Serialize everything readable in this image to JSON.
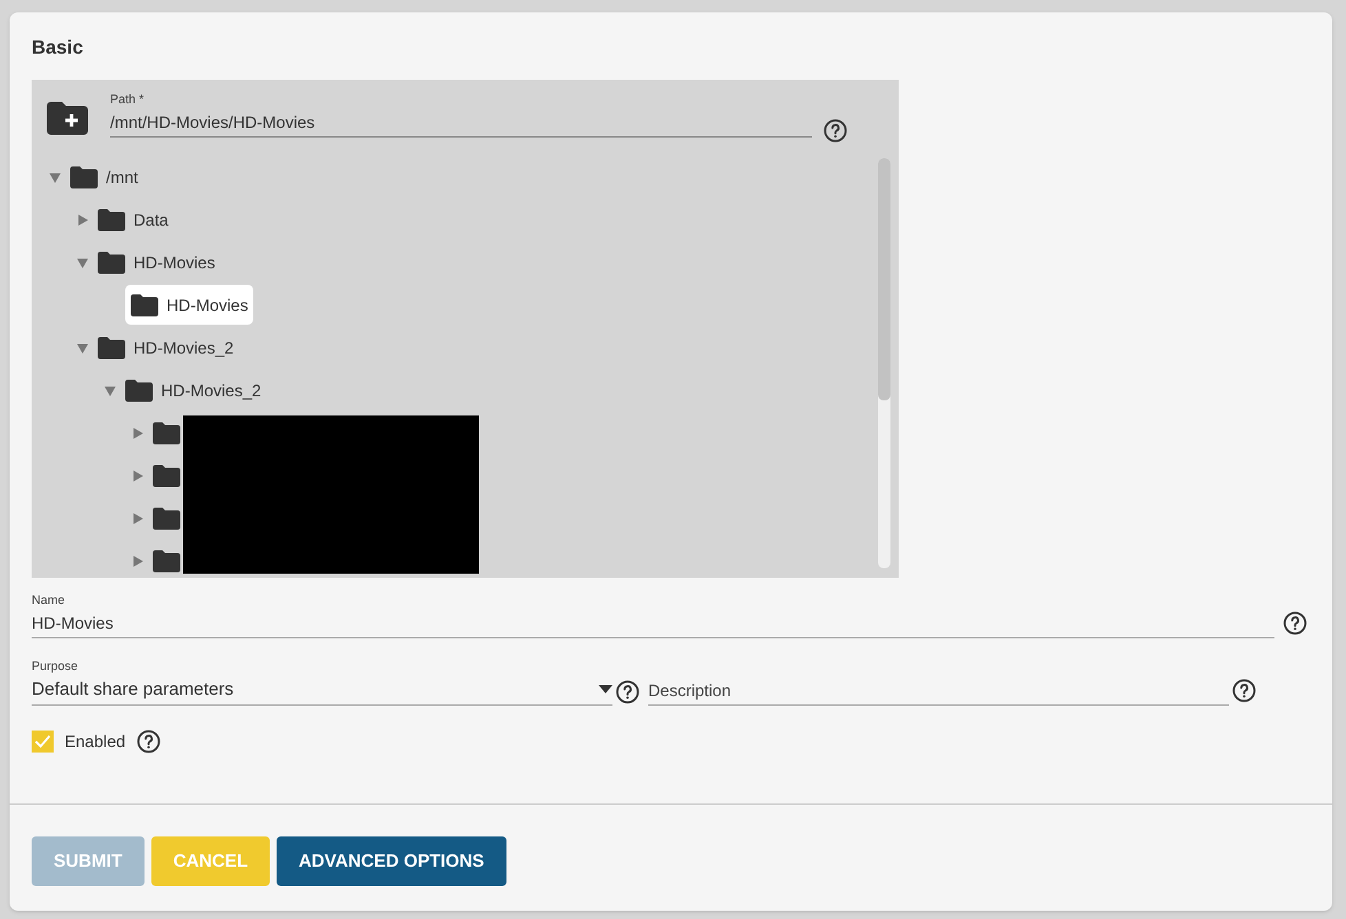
{
  "section_title": "Basic",
  "path_field": {
    "label": "Path *",
    "value": "/mnt/HD-Movies/HD-Movies"
  },
  "tree": [
    {
      "name": "/mnt",
      "expanded": true,
      "selected": false,
      "children": [
        {
          "name": "Data",
          "expanded": false,
          "selected": false
        },
        {
          "name": "HD-Movies",
          "expanded": true,
          "selected": false,
          "children": [
            {
              "name": "HD-Movies",
              "selected": true
            }
          ]
        },
        {
          "name": "HD-Movies_2",
          "expanded": true,
          "selected": false,
          "children": [
            {
              "name": "HD-Movies_2",
              "expanded": true,
              "selected": false,
              "children": [
                {
                  "expanded": false,
                  "selected": false
                },
                {
                  "expanded": false,
                  "selected": false
                },
                {
                  "expanded": false,
                  "selected": false
                },
                {
                  "expanded": false,
                  "selected": false
                }
              ]
            }
          ]
        }
      ]
    }
  ],
  "name_field": {
    "label": "Name",
    "value": "HD-Movies"
  },
  "purpose_field": {
    "label": "Purpose",
    "value": "Default share parameters"
  },
  "description_field": {
    "placeholder": "Description"
  },
  "enabled": {
    "label": "Enabled",
    "checked": true
  },
  "buttons": [
    {
      "label": "SUBMIT",
      "kind": "primary",
      "disabled": true
    },
    {
      "label": "CANCEL",
      "kind": "warning",
      "disabled": false
    },
    {
      "label": "ADVANCED OPTIONS",
      "kind": "primary",
      "disabled": false
    }
  ]
}
